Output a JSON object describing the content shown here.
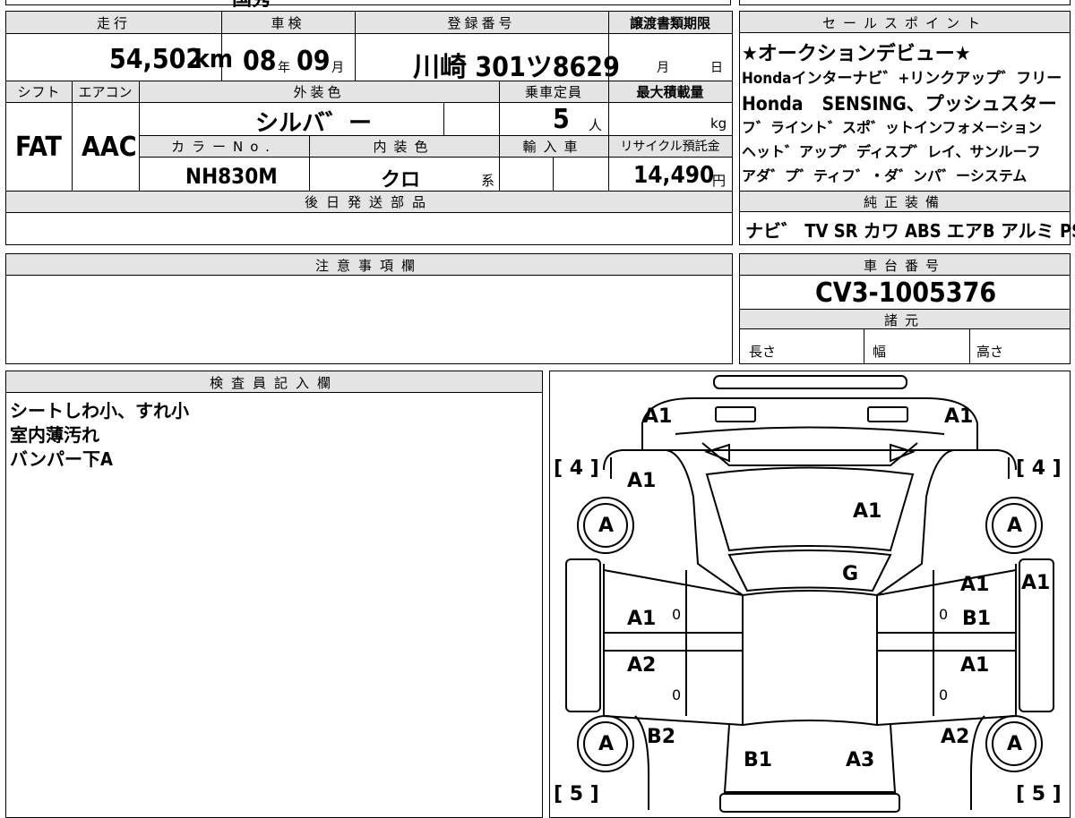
{
  "top_fragment": "国秀",
  "mileage": {
    "header": "走行",
    "value": "54,502",
    "unit": "km"
  },
  "inspection": {
    "header": "車検",
    "year": "08",
    "year_unit": "年",
    "month": "09",
    "month_unit": "月"
  },
  "registration": {
    "header": "登録番号",
    "value": "川崎 301ツ8629"
  },
  "transfer_deadline": {
    "header": "譲渡書類期限",
    "month_unit": "月",
    "day_unit": "日"
  },
  "shift": {
    "header": "シフト",
    "value": "FAT"
  },
  "aircon": {
    "header": "エアコン",
    "value": "AAC"
  },
  "exterior_color": {
    "header": "外装色",
    "value": "シルバ゛ー"
  },
  "capacity": {
    "header": "乗車定員",
    "value": "5",
    "unit": "人"
  },
  "max_load": {
    "header": "最大積載量",
    "unit": "kg"
  },
  "color_no": {
    "header": "カラーNo.",
    "value": "NH830M"
  },
  "interior_color": {
    "header": "内装色",
    "value": "クロ",
    "suffix": "系"
  },
  "import": {
    "header": "輸入車"
  },
  "recycle": {
    "header": "リサイクル預託金",
    "value": "14,490",
    "unit": "円"
  },
  "later_parts": {
    "header": "後日発送部品"
  },
  "notes": {
    "header": "注意事項欄"
  },
  "sales_points": {
    "header": "セールスポイント",
    "lines": [
      "★オークションデビュー★",
      "Hondaインターナビ゛+リンクアップ゛フリー",
      "Honda　SENSING、プッシュスター",
      "フ゛ライント゛スポ゛ットインフォメーション",
      "ヘット゛アップ゛ディスプ゛レイ、サンルーフ",
      "アダ゛プ゛ティフ゛・ダ゛ンパ゛ーシステム"
    ]
  },
  "equipment": {
    "header": "純正装備",
    "value": "ナビ゛ TV SR カワ ABS エアB アルミ PS PW"
  },
  "chassis": {
    "header": "車台番号",
    "value": "CV3-1005376"
  },
  "specs": {
    "header": "諸元",
    "length": "長さ",
    "width": "幅",
    "height": "高さ"
  },
  "inspector": {
    "header": "検査員記入欄",
    "lines": [
      "シートしわ小、すれ小",
      "室内薄汚れ",
      "バンパー下A"
    ]
  },
  "diagram": {
    "labels": {
      "front_left": "A1",
      "front_right": "A1",
      "hood": "A1",
      "fender_fl": "A1",
      "windshield": "G",
      "roof_side_right": "A1",
      "door_fl": "A1",
      "door_fr": "B1",
      "quarter_right": "A1",
      "door_rl": "A2",
      "door_rr": "A1",
      "rear_fender_l": "B2",
      "rear_fender_r": "A2",
      "trunk_l": "B1",
      "trunk_r": "A3",
      "tire_fl": "A",
      "tire_fr": "A",
      "tire_rl": "A",
      "tire_rr": "A",
      "zero1": "0",
      "zero2": "0",
      "zero3": "0",
      "zero4": "0"
    },
    "tread": {
      "fl": "[ 4 ]",
      "fr": "[ 4 ]",
      "rl": "[ 5 ]",
      "rr": "[ 5 ]"
    }
  }
}
